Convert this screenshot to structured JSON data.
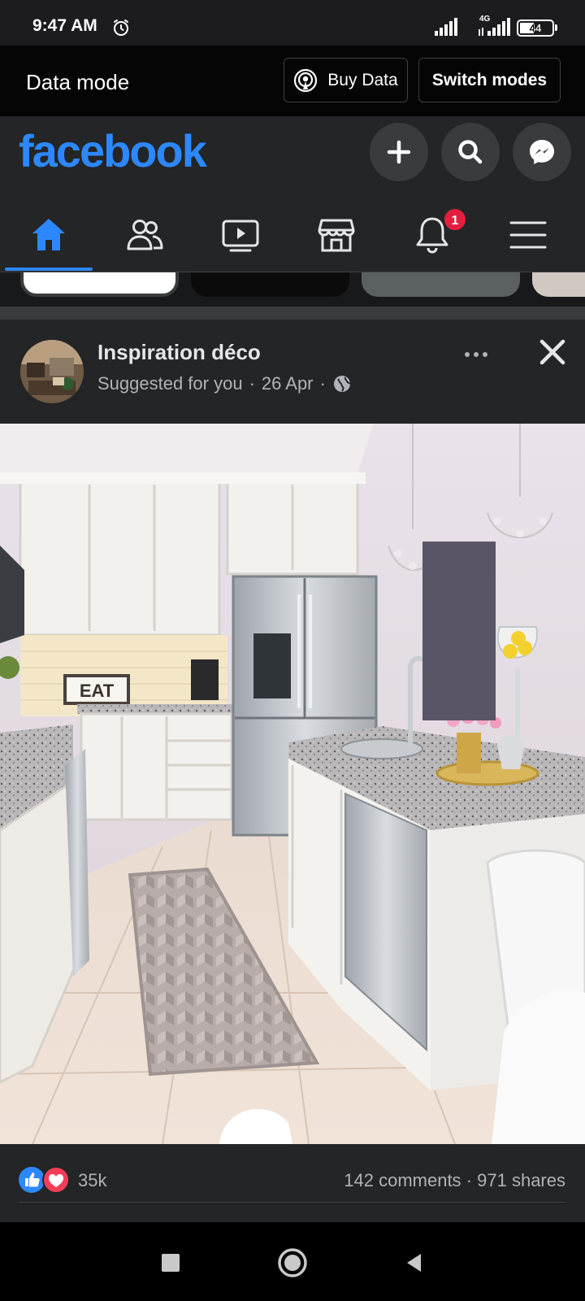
{
  "status_bar": {
    "time": "9:47 AM",
    "network": "4G",
    "battery": "44",
    "icons": [
      "alarm-icon",
      "signal-icon",
      "signal-4g-icon",
      "battery-icon"
    ]
  },
  "data_mode": {
    "title": "Data mode",
    "buy_data_label": "Buy Data",
    "switch_modes_label": "Switch modes"
  },
  "header": {
    "logo": "facebook",
    "icons": [
      "plus-icon",
      "search-icon",
      "messenger-icon"
    ]
  },
  "nav": {
    "tabs": [
      "home-icon",
      "friends-icon",
      "watch-icon",
      "marketplace-icon",
      "notifications-icon",
      "menu-icon"
    ],
    "active": "home",
    "notification_badge": "1"
  },
  "post": {
    "page_name": "Inspiration déco",
    "suggested": "Suggested for you",
    "date": "26 Apr",
    "privacy_icon": "globe-icon",
    "reaction_count": "35k",
    "comments": "142 comments",
    "shares": "971 shares",
    "image_sign_text": "EAT"
  },
  "colors": {
    "accent": "#2d88ff",
    "background": "#18191a",
    "surface": "#242526",
    "badge": "#e41e3f"
  }
}
